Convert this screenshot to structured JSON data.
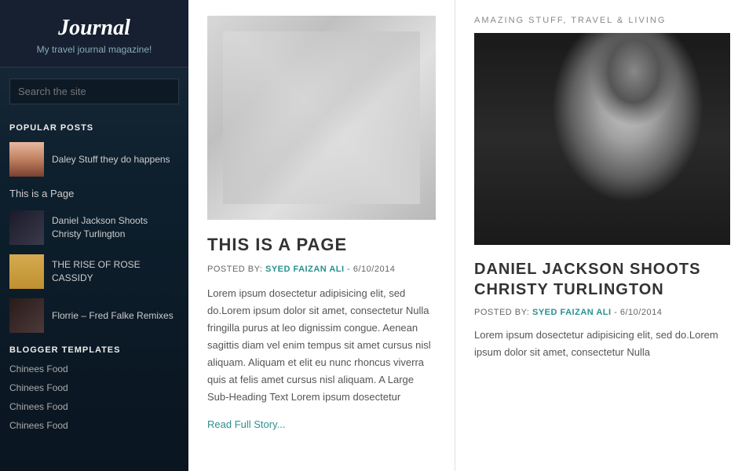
{
  "sidebar": {
    "title": "Journal",
    "subtitle": "My travel journal magazine!",
    "search_placeholder": "Search the site",
    "popular_posts_label": "POPULAR POSTS",
    "posts": [
      {
        "title": "Daley Stuff they do happens"
      },
      {
        "title": "Daniel Jackson Shoots Christy Turlington"
      },
      {
        "title": "THE RISE OF ROSE CASSIDY"
      },
      {
        "title": "Florrie – Fred Falke Remixes"
      }
    ],
    "page_link": "This is a Page",
    "blogger_label": "BLOGGER TEMPLATES",
    "blogger_links": [
      "Chinees Food",
      "Chinees Food",
      "Chinees Food",
      "Chinees Food"
    ]
  },
  "center_article": {
    "title": "THIS IS A PAGE",
    "meta_prefix": "POSTED BY:",
    "meta_author": "SYED FAIZAN ALI",
    "meta_date": "- 6/10/2014",
    "body": "Lorem ipsum dosectetur adipisicing elit, sed do.Lorem ipsum dolor sit amet, consectetur Nulla fringilla purus at leo dignissim congue. Aenean sagittis diam vel enim tempus sit amet cursus nisl aliquam. Aliquam et elit eu nunc rhoncus viverra quis at felis amet cursus nisl aliquam. A Large Sub-Heading Text Lorem ipsum dosectetur",
    "read_more": "Read Full Story..."
  },
  "right_article": {
    "category": "AMAZING STUFF, TRAVEL & LIVING",
    "title": "DANIEL JACKSON SHOOTS CHRISTY TURLINGTON",
    "meta_prefix": "POSTED BY:",
    "meta_author": "SYED FAIZAN ALI",
    "meta_date": "- 6/10/2014",
    "body": "Lorem ipsum dosectetur adipisicing elit, sed do.Lorem ipsum dolor sit amet, consectetur Nulla"
  }
}
